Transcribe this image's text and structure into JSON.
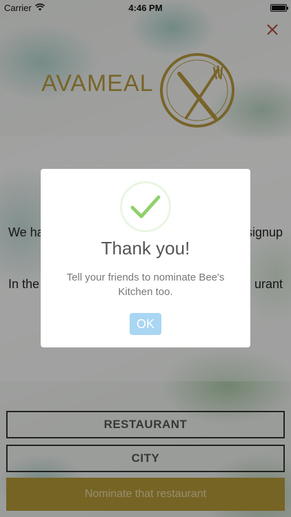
{
  "status_bar": {
    "carrier": "Carrier",
    "time": "4:46 PM"
  },
  "header": {
    "logo_text": "AVAMEAL"
  },
  "body": {
    "line1_left": "We ha",
    "line1_right": "signup",
    "line2_left": "In the",
    "line2_right": "urant"
  },
  "form": {
    "restaurant_placeholder": "RESTAURANT",
    "city_placeholder": "CITY",
    "submit_label": "Nominate that restaurant"
  },
  "dialog": {
    "icon": "checkmark-icon",
    "title": "Thank you!",
    "message": "Tell your friends to nominate Bee's Kitchen too.",
    "ok_label": "OK"
  },
  "colors": {
    "brand_gold": "#b69a3a",
    "ok_button": "#a9d6f3",
    "check_green": "#8fd16a"
  }
}
